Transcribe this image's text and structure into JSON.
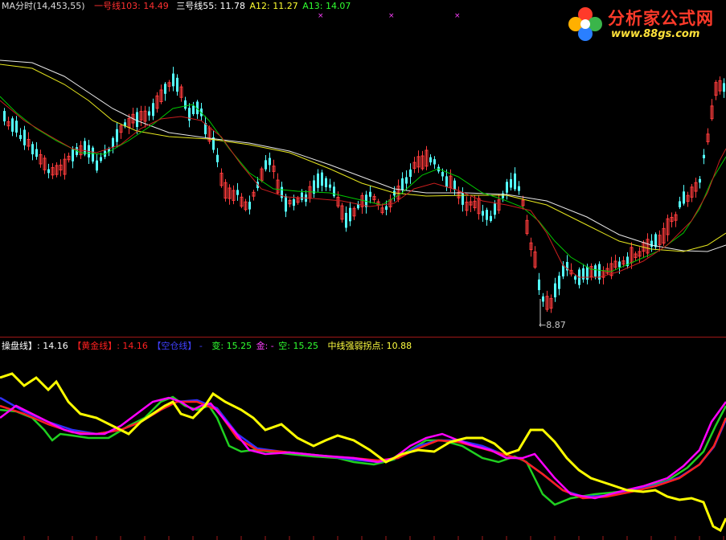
{
  "top_legend": {
    "title": "MA分时(14,453,55)",
    "line1_label": "一号线103: 14.49",
    "line3_label": "三号线55: 11.78",
    "a12_label": "A12: 11.27",
    "a13_label": "A13: 14.07"
  },
  "bottom_legend": {
    "cao_label": "操盘线】: 14.16",
    "gold_label": "【黄金线】: 14.16",
    "empty_label": "【空仓线】 -",
    "bian_label": "变: 15.25",
    "jin_label": "金: -",
    "kong_label": "空: 15.25",
    "mid_label": "中线强弱拐点: 10.88"
  },
  "low_marker": "←8.87",
  "logo": {
    "name": "分析家公式网",
    "url": "www.88gs.com"
  },
  "colors": {
    "up_candle": "#ff3c3c",
    "down_candle": "#54ffff",
    "ma_white": "#e8e8e8",
    "ma_yellow": "#e6e61e",
    "ma_green": "#00c800",
    "ma_red": "#c81e1e",
    "osc_yellow": "#ffff00",
    "osc_magenta": "#ff00ff",
    "osc_red": "#ff2020",
    "osc_blue": "#3030ff",
    "osc_green": "#20d020",
    "separator": "#a01818"
  }
}
